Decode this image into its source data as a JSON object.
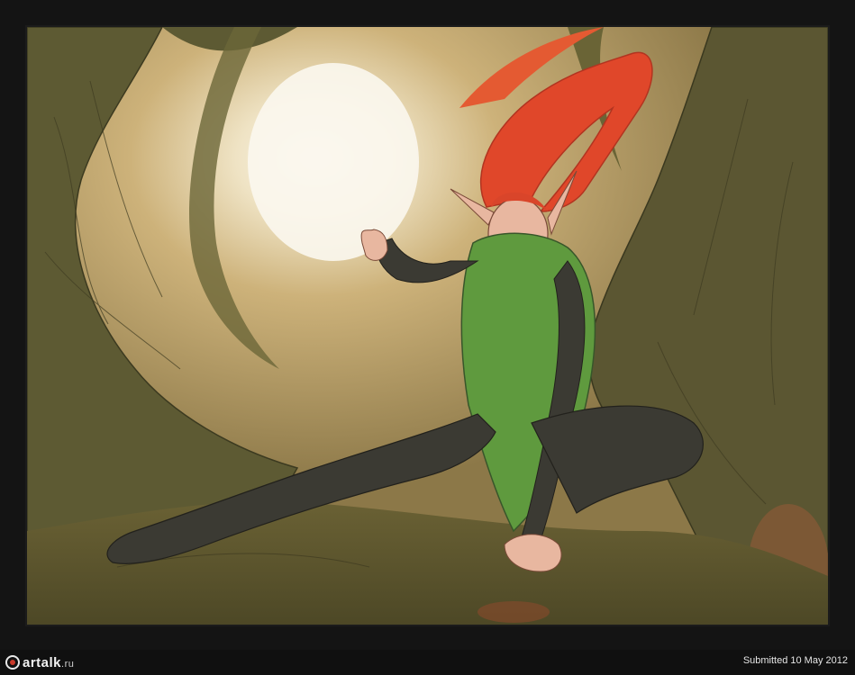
{
  "footer": {
    "logo_text": "artalk",
    "logo_tld": ".ru",
    "submitted": "Submitted 10 May 2012"
  },
  "artwork": {
    "subject": "elf-character-crouching-in-forest",
    "colors": {
      "background": "#141414",
      "tree": "#5c5a34",
      "glow": "#f4ecd6",
      "hair": "#e0472a",
      "tunic": "#5f9a3e",
      "leggings": "#3b3a33",
      "skin": "#e8b7a0"
    }
  }
}
